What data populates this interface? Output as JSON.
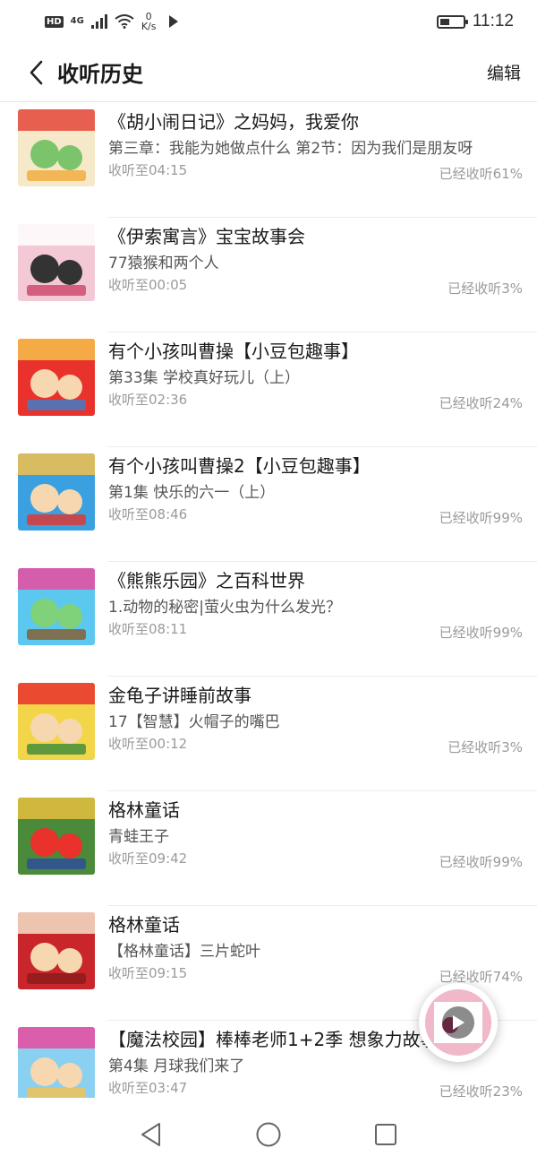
{
  "status_bar": {
    "hd": "HD",
    "network": "4G",
    "speed_value": "0",
    "speed_unit": "K/s",
    "battery_level": 0.4,
    "time": "11:12"
  },
  "header": {
    "back_icon": "chevron-left-icon",
    "title": "收听历史",
    "edit_label": "编辑"
  },
  "items": [
    {
      "title": "《胡小闹日记》之妈妈，我爱你",
      "chapter": "第三章：我能为她做点什么 第2节：因为我们是朋友呀",
      "position": "收听至04:15",
      "progress": "已经收听61%",
      "cover_colors": [
        "#f6e9c9",
        "#e4483a",
        "#f2a93b",
        "#7cc46b"
      ]
    },
    {
      "title": "《伊索寓言》宝宝故事会",
      "chapter": "77猿猴和两个人",
      "position": "收听至00:05",
      "progress": "已经收听3%",
      "cover_colors": [
        "#f2c9d4",
        "#ffffff",
        "#cc4466",
        "#333333"
      ]
    },
    {
      "title": "有个小孩叫曹操【小豆包趣事】",
      "chapter": "第33集 学校真好玩儿（上）",
      "position": "收听至02:36",
      "progress": "已经收听24%",
      "cover_colors": [
        "#e8322b",
        "#f6c04a",
        "#3a7fd0",
        "#f6d7b0"
      ]
    },
    {
      "title": "有个小孩叫曹操2【小豆包趣事】",
      "chapter": "第1集 快乐的六一（上）",
      "position": "收听至08:46",
      "progress": "已经收听99%",
      "cover_colors": [
        "#3aa0e0",
        "#f6c04a",
        "#e8322b",
        "#f6d7b0"
      ]
    },
    {
      "title": "《熊熊乐园》之百科世界",
      "chapter": "1.动物的秘密|萤火虫为什么发光？",
      "position": "收听至08:11",
      "progress": "已经收听99%",
      "cover_colors": [
        "#5cc8f0",
        "#e94aa0",
        "#8a5a2b",
        "#7fd17a"
      ]
    },
    {
      "title": "金龟子讲睡前故事",
      "chapter": "17【智慧】火帽子的嘴巴",
      "position": "收听至00:12",
      "progress": "已经收听3%",
      "cover_colors": [
        "#f3d54a",
        "#e8322b",
        "#3a8a3a",
        "#f6d7b0"
      ]
    },
    {
      "title": "格林童话",
      "chapter": "青蛙王子",
      "position": "收听至09:42",
      "progress": "已经收听99%",
      "cover_colors": [
        "#4a8a3a",
        "#e8c040",
        "#2a4aa0",
        "#e8322b"
      ]
    },
    {
      "title": "格林童话",
      "chapter": "【格林童话】三片蛇叶",
      "position": "收听至09:15",
      "progress": "已经收听74%",
      "cover_colors": [
        "#c8262a",
        "#f2e0c8",
        "#8a1a1a",
        "#f6d7b0"
      ]
    },
    {
      "title": "【魔法校园】棒棒老师1+2季 想象力故事",
      "chapter": "第4集 月球我们来了",
      "position": "收听至03:47",
      "progress": "已经收听23%",
      "cover_colors": [
        "#8ad0f0",
        "#e94aa0",
        "#f6c04a",
        "#f6d7b0"
      ]
    }
  ],
  "mini_player": {
    "icon": "play-icon",
    "cover_colors": [
      "#f0b8c8",
      "#ffffff",
      "#b84a7a"
    ]
  },
  "nav_bar": {
    "back_icon": "triangle-back-icon",
    "home_icon": "circle-home-icon",
    "recents_icon": "square-recents-icon"
  }
}
